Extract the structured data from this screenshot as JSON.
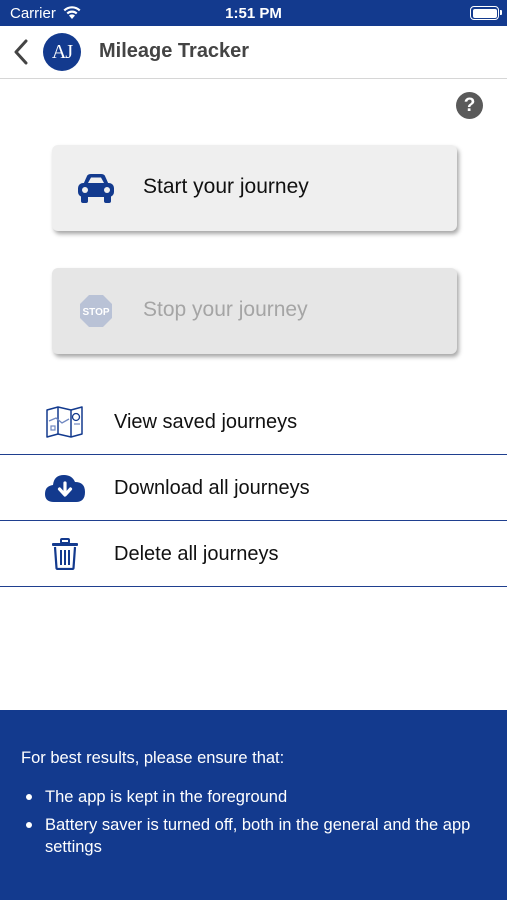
{
  "status_bar": {
    "carrier": "Carrier",
    "time": "1:51 PM"
  },
  "nav": {
    "avatar_initials": "AJ",
    "title": "Mileage Tracker"
  },
  "help": {
    "symbol": "?"
  },
  "actions": {
    "start_label": "Start your journey",
    "stop_label": "Stop your journey",
    "stop_icon_text": "STOP"
  },
  "list": {
    "view_label": "View saved journeys",
    "download_label": "Download all journeys",
    "delete_label": "Delete all journeys"
  },
  "footer": {
    "intro": "For best results, please ensure that:",
    "tips": [
      "The app is kept in the foreground",
      "Battery saver is turned off, both in the general and the app settings"
    ]
  },
  "colors": {
    "brand": "#133a8e",
    "divider": "#1f3f8f",
    "button_bg": "#efefef"
  },
  "icons": [
    "wifi-icon",
    "battery-icon",
    "back-chevron-icon",
    "help-icon",
    "car-icon",
    "stop-sign-icon",
    "map-icon",
    "cloud-download-icon",
    "trash-icon"
  ]
}
